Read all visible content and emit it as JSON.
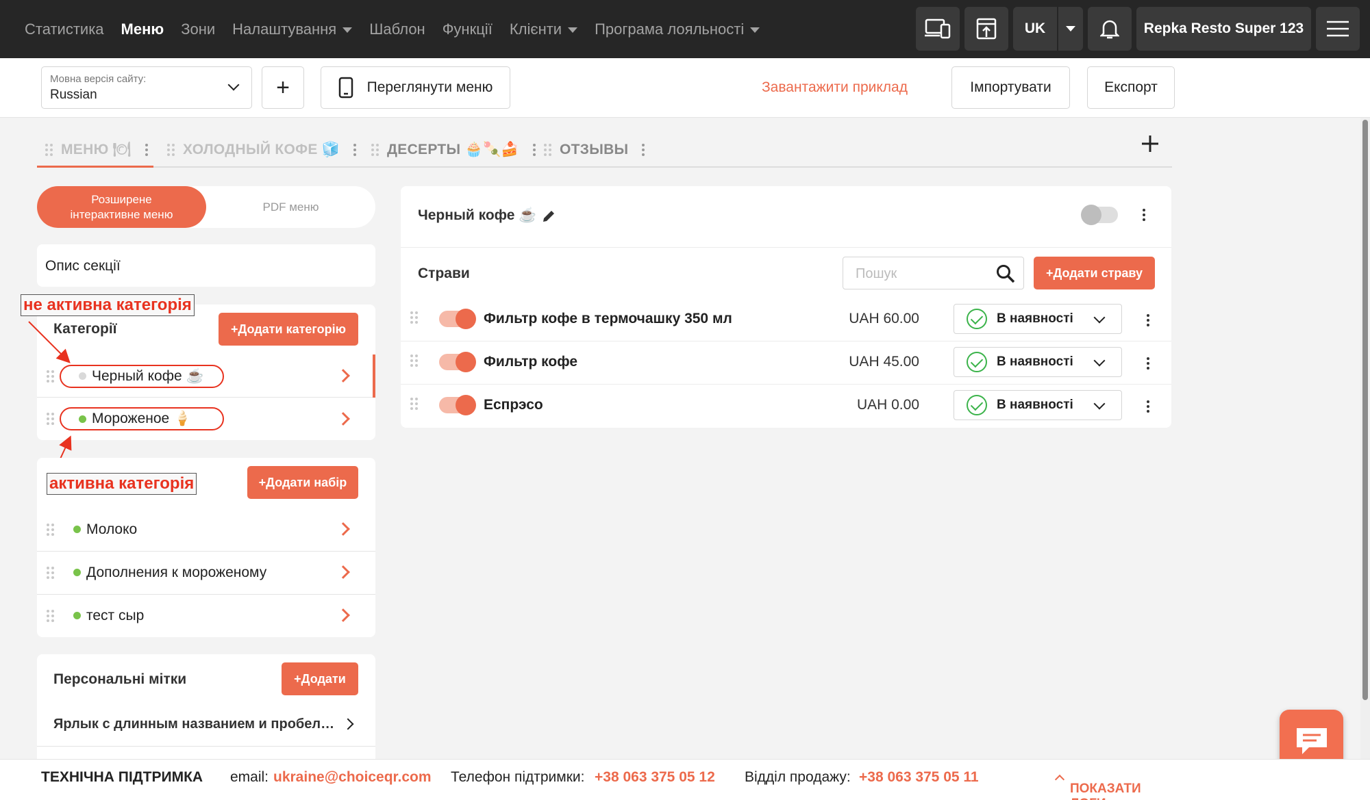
{
  "topnav": {
    "items": [
      "Статистика",
      "Меню",
      "Зони",
      "Налаштування",
      "Шаблон",
      "Функції",
      "Клієнти",
      "Програма лояльності"
    ],
    "lang": "UK",
    "account": "Repka Resto Super 123"
  },
  "toolbar": {
    "lang_select_label": "Мовна версія сайту:",
    "lang_select_value": "Russian",
    "add": "+",
    "preview_label": "Переглянути меню",
    "download_example": "Завантажити приклад",
    "import_label": "Імпортувати",
    "export_label": "Експорт"
  },
  "tabs": [
    "МЕНЮ 🍽",
    "ХОЛОДНЫЙ КОФЕ 🧊",
    "ДЕСЕРТЫ 🧁🍡🍰",
    "ОТЗЫВЫ"
  ],
  "mode": {
    "extended": "Розширене інтерактивне меню",
    "pdf": "PDF меню"
  },
  "section_desc": "Опис секції",
  "annotations": {
    "inactive": "не активна категорія",
    "active": "активна категорія"
  },
  "categories": {
    "title": "Категорії",
    "add_button": "+Додати категорію",
    "items": [
      {
        "label": "Черный кофе ☕",
        "status_color": "#d9d9d9"
      },
      {
        "label": "Мороженое 🍦",
        "status_color": "#79c34a"
      }
    ]
  },
  "sets": {
    "add_button": "+Додати набір",
    "items": [
      {
        "label": "Молоко",
        "status_color": "#79c34a"
      },
      {
        "label": "Дополнения к мороженому",
        "status_color": "#79c34a"
      },
      {
        "label": "тест сыр",
        "status_color": "#79c34a"
      }
    ]
  },
  "tags": {
    "title": "Персональні мітки",
    "add_button": "+Додати",
    "items": [
      "Ярлык с длинным названием и пробел…"
    ]
  },
  "category_panel": {
    "title": "Черный кофе ☕",
    "dishes_label": "Страви",
    "search_placeholder": "Пошук",
    "add_dish": "+Додати страву",
    "dishes": [
      {
        "name": "Фильтр кофе в термочашку 350 мл",
        "price": "UAH 60.00",
        "status": "В наявності"
      },
      {
        "name": "Фильтр кофе",
        "price": "UAH 45.00",
        "status": "В наявності"
      },
      {
        "name": "Еспрэсо",
        "price": "UAH 0.00",
        "status": "В наявності"
      }
    ]
  },
  "footer": {
    "support": "ТЕХНІЧНА ПІДТРИМКА",
    "email_label": "email:",
    "email": "ukraine@choiceqr.com",
    "phone_label": "Телефон підтримки:",
    "phone": "+38 063 375 05 12",
    "sales_label": "Відділ продажу:",
    "sales_phone": "+38 063 375 05 11",
    "logs": "ПОКАЗАТИ ЛОГИ"
  },
  "colors": {
    "accent": "#ec6a4c",
    "topbar": "#262626",
    "active": "#79c34a",
    "inactive": "#d9d9d9"
  }
}
